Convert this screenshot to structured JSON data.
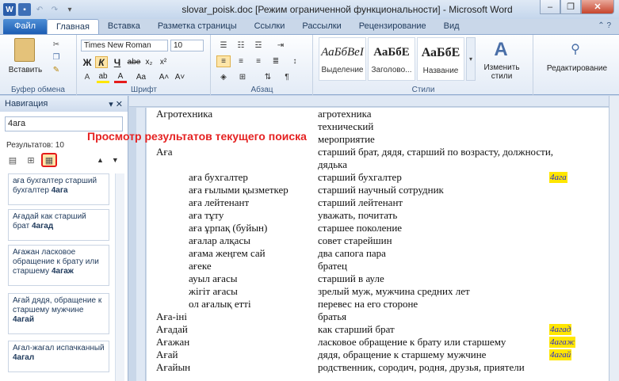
{
  "window": {
    "title": "slovar_poisk.doc [Режим ограниченной функциональности] - Microsoft Word"
  },
  "tabs": [
    "Файл",
    "Главная",
    "Вставка",
    "Разметка страницы",
    "Ссылки",
    "Рассылки",
    "Рецензирование",
    "Вид"
  ],
  "ribbon": {
    "clipboard": {
      "paste": "Вставить",
      "label": "Буфер обмена"
    },
    "font": {
      "name": "Times New Roman",
      "size": "10",
      "label": "Шрифт",
      "bold": "Ж",
      "italic": "К",
      "underline": "Ч",
      "strike": "abe",
      "sub": "x₂",
      "sup": "x²",
      "case": "Aa",
      "grow": "A˄",
      "shrink": "A˅"
    },
    "paragraph": {
      "label": "Абзац"
    },
    "styles": {
      "label": "Стили",
      "items": [
        {
          "sample": "АаБбВеI",
          "name": "Выделение"
        },
        {
          "sample": "АаБбЕ",
          "name": "Заголово..."
        },
        {
          "sample": "АаБбЕ",
          "name": "Название"
        }
      ],
      "change": "Изменить стили"
    },
    "editing": {
      "label": "Редактирование"
    }
  },
  "nav": {
    "title": "Навигация",
    "search": "4ага",
    "count": "Результатов: 10",
    "results": [
      {
        "text": "аға бухгалтер   старший бухгалтер",
        "term": "4ага"
      },
      {
        "text": "Ағадай   как старший брат",
        "term": "4агад"
      },
      {
        "text": "Ағажан   ласковое обращение к брату или старшему",
        "term": "4агаж"
      },
      {
        "text": "Ағай   дядя, обращение к старшему мужчине",
        "term": "4агай"
      },
      {
        "text": "Ағал-жағал испачканный",
        "term": "4агал"
      }
    ]
  },
  "callout": "Просмотр результатов текущего поиска",
  "doc": {
    "rows": [
      {
        "left": "Агротехника",
        "right": "агротехника",
        "indent": false,
        "hl": ""
      },
      {
        "left": "",
        "right": "технический",
        "indent": false,
        "hl": ""
      },
      {
        "left": "",
        "right": "мероприятие",
        "indent": false,
        "hl": ""
      },
      {
        "left": "Аға",
        "right": "старший брат, дядя, старший по возрасту, должности,",
        "indent": false,
        "hl": ""
      },
      {
        "left": "",
        "right": "дядька",
        "indent": false,
        "hl": ""
      },
      {
        "left": "аға бухгалтер",
        "right": "старший бухгалтер",
        "indent": true,
        "hl": "4ага"
      },
      {
        "left": "аға ғылыми қызметкер",
        "right": "старший научный сотрудник",
        "indent": true,
        "hl": ""
      },
      {
        "left": "аға лейтенант",
        "right": "старший лейтенант",
        "indent": true,
        "hl": ""
      },
      {
        "left": "аға тұту",
        "right": "уважать, почитать",
        "indent": true,
        "hl": ""
      },
      {
        "left": "аға ұрпақ (буйын)",
        "right": "старшее поколение",
        "indent": true,
        "hl": ""
      },
      {
        "left": "ағалар алқасы",
        "right": "совет старейшин",
        "indent": true,
        "hl": ""
      },
      {
        "left": "ағама жеңгем сай",
        "right": "два сапога пара",
        "indent": true,
        "hl": ""
      },
      {
        "left": "ағеке",
        "right": "братец",
        "indent": true,
        "hl": ""
      },
      {
        "left": "ауыл ағасы",
        "right": "старший в ауле",
        "indent": true,
        "hl": ""
      },
      {
        "left": "жігіт ағасы",
        "right": "зрелый муж, мужчина средних лет",
        "indent": true,
        "hl": ""
      },
      {
        "left": "ол ағалық етті",
        "right": "перевес на его стороне",
        "indent": true,
        "hl": ""
      },
      {
        "left": "Аға-іні",
        "right": "братья",
        "indent": false,
        "hl": ""
      },
      {
        "left": "Ағадай",
        "right": "как старший брат",
        "indent": false,
        "hl": "4агад"
      },
      {
        "left": "Ағажан",
        "right": "ласковое обращение к брату или старшему",
        "indent": false,
        "hl": "4агаж"
      },
      {
        "left": "Ағай",
        "right": "дядя, обращение к старшему мужчине",
        "indent": false,
        "hl": "4агай"
      },
      {
        "left": "Ағайын",
        "right": "родственник, сородич, родня, друзья,  приятели",
        "indent": false,
        "hl": ""
      }
    ]
  }
}
